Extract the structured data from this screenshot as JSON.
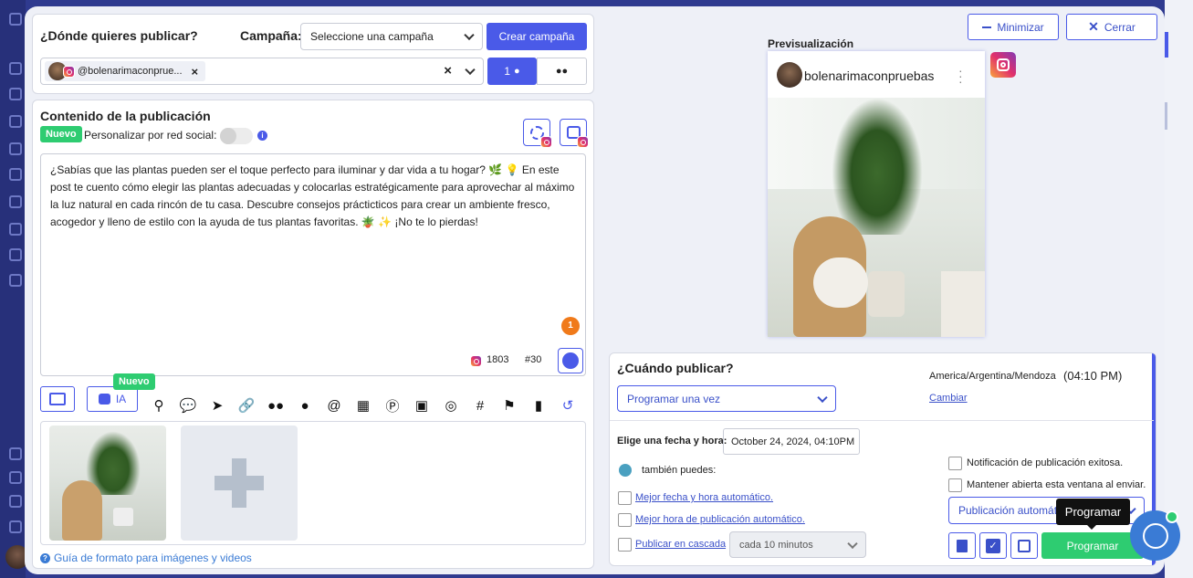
{
  "publish": {
    "title": "¿Dónde quieres publicar?",
    "campaign_label": "Campaña:",
    "campaign_select": "Seleccione una campaña",
    "create_campaign": "Crear campaña",
    "account_chip": "@bolenarimaconprue...",
    "count_single": "1"
  },
  "content": {
    "title": "Contenido de la publicación",
    "new_badge": "Nuevo",
    "personalize_label": "Personalizar por red social:",
    "post_text": "¿Sabías que las plantas pueden ser el toque perfecto para iluminar y dar vida a tu hogar? 🌿 💡  En este post te cuento cómo elegir las plantas adecuadas y colocarlas estratégicamente para aprovechar al máximo la luz natural en cada rincón de tu casa. Descubre consejos prácticticos para crear un ambiente fresco, acogedor y lleno de estilo con la ayuda de tus plantas favoritas. 🪴 ✨ ¡No te lo pierdas!",
    "notification_count": "1",
    "char_count": "1803",
    "hashtag_count": "#30",
    "ia_label": "IA",
    "ia_new_badge": "Nuevo",
    "format_guide": "Guía de formato para imágenes y videos"
  },
  "header": {
    "minimize": "Minimizar",
    "close": "Cerrar"
  },
  "preview": {
    "label": "Previsualización",
    "username": "bolenarimaconpruebas"
  },
  "schedule": {
    "title": "¿Cuándo publicar?",
    "timezone": "America/Argentina/Mendoza",
    "time": "04:10 PM",
    "change_link": "Cambiar",
    "frequency_select": "Programar una vez",
    "date_label": "Elige una fecha y hora:",
    "date_value": "October 24, 2024, 04:10PM",
    "also_label": "también puedes:",
    "best_datetime": "Mejor fecha y hora automático.",
    "best_time": "Mejor hora de publicación automático.",
    "cascade": "Publicar en cascada",
    "cascade_interval": "cada 10 minutos",
    "notify_success": "Notificación de publicación exitosa.",
    "keep_open": "Mantener abierta esta ventana al enviar.",
    "publish_mode": "Publicación automática",
    "schedule_button": "Programar",
    "tooltip": "Programar"
  },
  "colors": {
    "accent": "#4a5ae8",
    "green": "#2ecc71",
    "orange": "#f07a1a"
  }
}
